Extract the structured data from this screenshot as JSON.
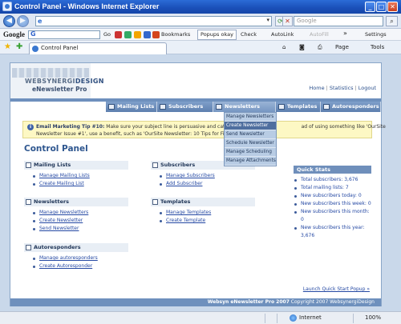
{
  "window": {
    "title": "Control Panel - Windows Internet Explorer",
    "minimize_glyph": "_",
    "maximize_glyph": "□",
    "close_glyph": "✕"
  },
  "address_bar": {
    "url": "",
    "search_placeholder": "Google"
  },
  "google_toolbar": {
    "logo": "Google",
    "search_letter": "G",
    "go_label": "Go",
    "bookmarks_label": "Bookmarks",
    "popups_label": "Popups okay",
    "check_label": "Check",
    "autolink_label": "AutoLink",
    "autofill_label": "AutoFill",
    "more_glyph": "»",
    "settings_label": "Settings"
  },
  "ie_tab": {
    "label": "Control Panel",
    "page_label": "Page",
    "tools_label": "Tools"
  },
  "app": {
    "logo_line1_a": "WEBSYNERGI",
    "logo_line1_b": "DESIGN",
    "logo_line2": "eNewsletter Pro",
    "top_links": [
      "Home",
      "Statistics",
      "Logout"
    ],
    "top_sep": "|",
    "nav_tabs": [
      "Mailing Lists",
      "Subscribers",
      "Newsletters",
      "Templates",
      "Autoresponders"
    ],
    "dropdown_items": [
      "Manage Newsletters",
      "Create Newsletter",
      "Send Newsletter",
      "Schedule Newsletter",
      "Manage Scheduling",
      "Manage Attachments"
    ],
    "tip": {
      "icon": "i",
      "title": "Email Marketing Tip #10:",
      "line1_rest": " Make sure your subject line is persuasive and catches your ",
      "line1_tail": "ad of using something like 'OurSite",
      "line2": "Newsletter Issue #1', use a benefit, such as 'OurSite Newsletter: 10 Tips for Financial F"
    },
    "page_title": "Control Panel",
    "sections": {
      "mailing_lists": {
        "title": "Mailing Lists",
        "links": [
          "Manage Mailing Lists",
          "Create Mailing List"
        ]
      },
      "subscribers": {
        "title": "Subscribers",
        "links": [
          "Manage Subscribers",
          "Add Subscriber"
        ]
      },
      "newsletters": {
        "title": "Newsletters",
        "links": [
          "Manage Newsletters",
          "Create Newsletter",
          "Send Newsletter"
        ]
      },
      "templates": {
        "title": "Templates",
        "links": [
          "Manage Templates",
          "Create Template"
        ]
      },
      "autoresponders": {
        "title": "Autoresponders",
        "links": [
          "Manage autoresponders",
          "Create Autoresponder"
        ]
      }
    },
    "quick_stats": {
      "title": "Quick Stats",
      "items": [
        "Total subscribers: 3,676",
        "Total mailing lists: 7",
        "New subscribers today: 0",
        "New subscribers this week: 0",
        "New subscribers this month: 0",
        "New subscribers this year:",
        "3,676"
      ]
    },
    "launch_link": "Launch Quick Start Popup »",
    "footer_bold": "Websyn eNewsletter Pro 2007",
    "footer_rest": " Copyright 2007 WebsynergiDesign"
  },
  "status_bar": {
    "status": "",
    "zone": "Internet",
    "zoom": "100%"
  }
}
